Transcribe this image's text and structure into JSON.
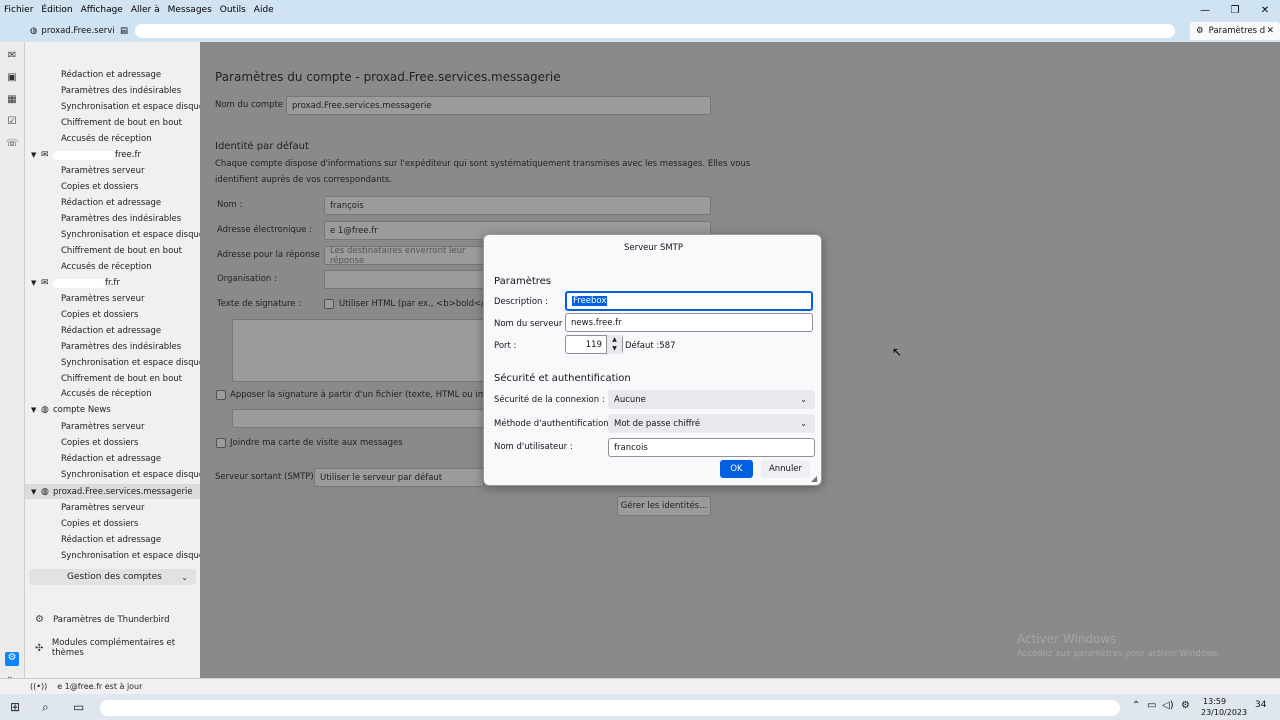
{
  "menubar": {
    "items": [
      "Fichier",
      "Édition",
      "Affichage",
      "Aller à",
      "Messages",
      "Outils",
      "Aide"
    ]
  },
  "window_controls": {
    "minimize": "—",
    "maximize": "❐",
    "close": "✕"
  },
  "tabs": {
    "first": "proxad.Free.servi",
    "active": "Paramètres d"
  },
  "sidebar": {
    "group0": [
      "Rédaction et adressage",
      "Paramètres des indésirables",
      "Synchronisation et espace disque",
      "Chiffrement de bout en bout",
      "Accusés de réception"
    ],
    "account1": "free.fr",
    "group1": [
      "Paramètres serveur",
      "Copies et dossiers",
      "Rédaction et adressage",
      "Paramètres des indésirables",
      "Synchronisation et espace disque",
      "Chiffrement de bout en bout",
      "Accusés de réception"
    ],
    "account2": "fr.fr",
    "group2": [
      "Paramètres serveur",
      "Copies et dossiers",
      "Rédaction et adressage",
      "Paramètres des indésirables",
      "Synchronisation et espace disque",
      "Chiffrement de bout en bout",
      "Accusés de réception"
    ],
    "account3": "compte News",
    "group3": [
      "Paramètres serveur",
      "Copies et dossiers",
      "Rédaction et adressage",
      "Synchronisation et espace disque"
    ],
    "account4": "proxad.Free.services.messagerie",
    "group4": [
      "Paramètres serveur",
      "Copies et dossiers",
      "Rédaction et adressage",
      "Synchronisation et espace disque"
    ],
    "manage_accounts": "Gestion des comptes",
    "thunderbird_settings": "Paramètres de Thunderbird",
    "addons": "Modules complémentaires et thèmes"
  },
  "main": {
    "title": "Paramètres du compte - proxad.Free.services.messagerie",
    "account_name_label": "Nom du compte :",
    "account_name_value": "proxad.Free.services.messagerie",
    "identity_heading": "Identité par défaut",
    "identity_desc1": "Chaque compte dispose d'informations sur l'expéditeur qui sont systématiquement transmises avec les messages. Elles vous",
    "identity_desc2": "identifient auprès de vos correspondants.",
    "name_label": "Nom :",
    "name_value": "françois",
    "email_label": "Adresse électronique :",
    "email_value": "e   1@free.fr",
    "reply_label": "Adresse pour la réponse :",
    "reply_placeholder": "Les destinataires enverront leur réponse",
    "org_label": "Organisation :",
    "signature_label": "Texte de signature :",
    "html_label": "Utiliser HTML (par ex., <b>bold</b>)",
    "attach_sig_label": "Apposer la signature à partir d'un fichier (texte, HTML ou image) :",
    "vcard_label": "Joindre ma carte de visite aux messages",
    "smtp_label": "Serveur sortant (SMTP) :",
    "smtp_value": "Utiliser le serveur par défaut",
    "manage_identities": "Gérer les identités..."
  },
  "dialog": {
    "title": "Serveur SMTP",
    "params_heading": "Paramètres",
    "description_label": "Description :",
    "description_value": "Freebox",
    "server_label": "Nom du serveur :",
    "server_value": "news.free.fr",
    "port_label": "Port :",
    "port_value": "119",
    "port_default": "Défaut :587",
    "security_heading": "Sécurité et authentification",
    "conn_security_label": "Sécurité de la connexion :",
    "conn_security_value": "Aucune",
    "auth_method_label": "Méthode d'authentification :",
    "auth_method_value": "Mot de passe chiffré",
    "username_label": "Nom d'utilisateur :",
    "username_value": "francois",
    "ok": "OK",
    "cancel": "Annuler"
  },
  "status": {
    "text": "e   1@free.fr est à jour"
  },
  "watermark": {
    "line1": "Activer Windows",
    "line2": "Accédez aux paramètres pour activer Windows."
  },
  "taskbar": {
    "time": "13:59",
    "date": "23/10/2023",
    "notif_count": "34"
  },
  "colors": {
    "accent": "#0061e0",
    "menubar": "#cfe3f3",
    "sidebar": "#f0f0f0"
  }
}
